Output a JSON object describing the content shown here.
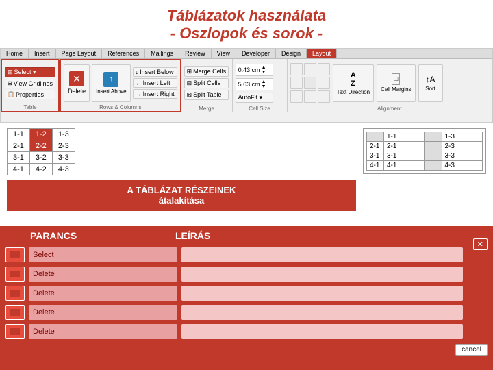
{
  "title": {
    "line1": "Táblázatok használata",
    "line2": "- Oszlopok és sorok -"
  },
  "ribbon": {
    "tabs": [
      "Home",
      "Insert",
      "Page Layout",
      "References",
      "Mailings",
      "Review",
      "View",
      "Developer",
      "Design",
      "Layout"
    ],
    "active_tab": "Layout",
    "sections": [
      {
        "name": "Table",
        "buttons": [
          "Select ▾",
          "View Gridlines",
          "Properties"
        ]
      },
      {
        "name": "Rows & Columns",
        "buttons": [
          "Delete",
          "Insert Above",
          "Insert Below",
          "Insert Left",
          "Insert Right"
        ]
      },
      {
        "name": "Merge",
        "buttons": [
          "Merge Cells",
          "Split Cells",
          "Split Table"
        ]
      },
      {
        "name": "Cell Size",
        "fields": [
          "0.43 cm",
          "5.63 cm"
        ],
        "buttons": [
          "AutoFit ▾"
        ]
      },
      {
        "name": "Alignment",
        "buttons": [
          "Text Direction",
          "Cell Margins",
          "Sort"
        ]
      }
    ]
  },
  "left_table": {
    "rows": [
      [
        "1-1",
        "1-2",
        "1-3"
      ],
      [
        "2-1",
        "2-2",
        "2-3"
      ],
      [
        "3-1",
        "3-2",
        "3-3"
      ],
      [
        "4-1",
        "4-2",
        "4-3"
      ]
    ],
    "highlight": [
      0,
      1
    ]
  },
  "right_table": {
    "rows": [
      [
        "",
        "1-1",
        "",
        "1-3"
      ],
      [
        "2-1",
        "2-1",
        "",
        "2-3"
      ],
      [
        "3-1",
        "3-1",
        "",
        "3-3"
      ],
      [
        "4-1",
        "4-1",
        "",
        "4-3"
      ]
    ],
    "headers": [
      "1-1",
      "1-3"
    ],
    "data": [
      {
        "c1": "2-1",
        "c2": "2-3"
      },
      {
        "c1": "3-1",
        "c2": "3-3"
      },
      {
        "c1": "4-1",
        "c2": "4-3"
      }
    ]
  },
  "info_box": {
    "line1": "A TÁBLÁZAT RÉSZEINEK",
    "line2": "átalakítása"
  },
  "dialog": {
    "col1_header": "PARANCS",
    "col2_header": "LEÍRÁS",
    "rows": [
      {
        "icon": "select",
        "label": "Select",
        "desc": ""
      },
      {
        "icon": "delete",
        "label": "Delete",
        "desc": ""
      },
      {
        "icon": "delete",
        "label": "Delete",
        "desc": ""
      },
      {
        "icon": "delete",
        "label": "Delete",
        "desc": ""
      },
      {
        "icon": "delete",
        "label": "Delete",
        "desc": ""
      }
    ],
    "close_btn": "✕",
    "cancel_btn": "cancel"
  }
}
